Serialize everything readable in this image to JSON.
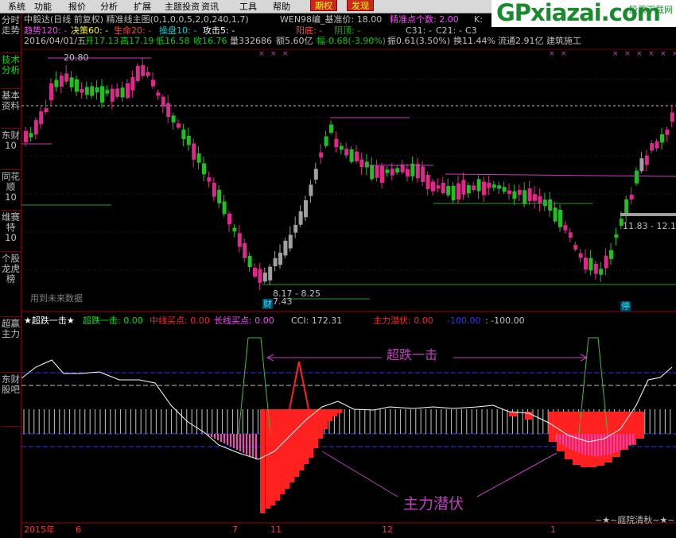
{
  "menu": [
    "系统",
    "功能",
    "报价",
    "分析",
    "扩展",
    "主题投资",
    "资讯",
    "工具",
    "帮助",
    "期权",
    "发现"
  ],
  "logo": {
    "main": "GPxiazai.com",
    "sub": "股票下载网"
  },
  "sidetabs": [
    "分时走势",
    "技术分析",
    "基本资料",
    "东财10",
    "同花顺10",
    "维赛特10",
    "个股龙虎榜",
    "超赢主力",
    "东财股吧"
  ],
  "header": {
    "title": "中毅达(日线 前复权) 精准线主图(0,1,0,0,5,2,0,240,1,7)",
    "wen": "WEN98编_基准价: 18.00",
    "jz_label": "精准点个数: 2.00",
    "k": "K:",
    "row2": {
      "qs": "趋势120: -",
      "jc": "决策60: -",
      "sm": "生命20: -",
      "cp": "操盘10: -",
      "gj": "攻击5: -"
    },
    "row3": {
      "date": "2016/04/01/五",
      "open": "开17.13",
      "high": "高17.19",
      "low": "低16.58",
      "close": "收16.76",
      "vol": "量332686",
      "amt": "额5.60亿",
      "chg": "幅-0.68(-3.90%)",
      "amp": "振0.61(3.50%)",
      "turn": "换11.44%",
      "float": "流通2.91亿",
      "ind": "建筑施工"
    },
    "yangdi": "阳底: -",
    "yinding": "阴顶: -",
    "c31": "C31: -",
    "c21": "C21: -",
    "c3": "C3"
  },
  "annotations": {
    "hi": "20.80",
    "lo_range": "8.17 - 8.25",
    "lo": "7.43",
    "range_right": "11.83 - 12.1",
    "future": "用到未来数据",
    "cai": "财",
    "ting": "停"
  },
  "indicator": {
    "name": "★超跌一击★",
    "sig": "超跌一击: 0.00",
    "mid": "中线买点: 0.00",
    "long": "长线买点: 0.00",
    "cci": "CCI: 172.31",
    "main": "主力潜伏: 0.00",
    "neg": "-100.00",
    "negv": ": -100.00",
    "label1": "超跌一击",
    "label2": "主力潜伏",
    "credit": "~★~庭院清秋~★~"
  },
  "xaxis": [
    "2015年",
    "6",
    "7",
    "11",
    "12",
    "1"
  ],
  "colors": {
    "up": "#ff3c3c",
    "upfill": "#e0288c",
    "down": "#20c020",
    "grey": "#a0a0a0",
    "mag": "#c040c0",
    "red": "#ff2020",
    "yellow": "#ffff00",
    "cyan": "#00c0c0",
    "blue": "#3030ff"
  }
}
